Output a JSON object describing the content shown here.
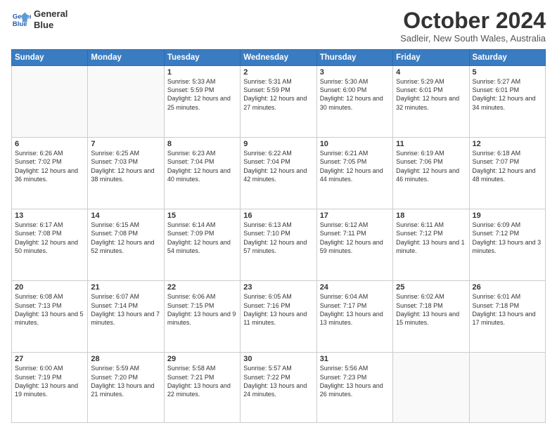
{
  "header": {
    "logo_line1": "General",
    "logo_line2": "Blue",
    "month": "October 2024",
    "location": "Sadleir, New South Wales, Australia"
  },
  "weekdays": [
    "Sunday",
    "Monday",
    "Tuesday",
    "Wednesday",
    "Thursday",
    "Friday",
    "Saturday"
  ],
  "weeks": [
    [
      {
        "day": "",
        "sunrise": "",
        "sunset": "",
        "daylight": ""
      },
      {
        "day": "",
        "sunrise": "",
        "sunset": "",
        "daylight": ""
      },
      {
        "day": "1",
        "sunrise": "Sunrise: 5:33 AM",
        "sunset": "Sunset: 5:59 PM",
        "daylight": "Daylight: 12 hours and 25 minutes."
      },
      {
        "day": "2",
        "sunrise": "Sunrise: 5:31 AM",
        "sunset": "Sunset: 5:59 PM",
        "daylight": "Daylight: 12 hours and 27 minutes."
      },
      {
        "day": "3",
        "sunrise": "Sunrise: 5:30 AM",
        "sunset": "Sunset: 6:00 PM",
        "daylight": "Daylight: 12 hours and 30 minutes."
      },
      {
        "day": "4",
        "sunrise": "Sunrise: 5:29 AM",
        "sunset": "Sunset: 6:01 PM",
        "daylight": "Daylight: 12 hours and 32 minutes."
      },
      {
        "day": "5",
        "sunrise": "Sunrise: 5:27 AM",
        "sunset": "Sunset: 6:01 PM",
        "daylight": "Daylight: 12 hours and 34 minutes."
      }
    ],
    [
      {
        "day": "6",
        "sunrise": "Sunrise: 6:26 AM",
        "sunset": "Sunset: 7:02 PM",
        "daylight": "Daylight: 12 hours and 36 minutes."
      },
      {
        "day": "7",
        "sunrise": "Sunrise: 6:25 AM",
        "sunset": "Sunset: 7:03 PM",
        "daylight": "Daylight: 12 hours and 38 minutes."
      },
      {
        "day": "8",
        "sunrise": "Sunrise: 6:23 AM",
        "sunset": "Sunset: 7:04 PM",
        "daylight": "Daylight: 12 hours and 40 minutes."
      },
      {
        "day": "9",
        "sunrise": "Sunrise: 6:22 AM",
        "sunset": "Sunset: 7:04 PM",
        "daylight": "Daylight: 12 hours and 42 minutes."
      },
      {
        "day": "10",
        "sunrise": "Sunrise: 6:21 AM",
        "sunset": "Sunset: 7:05 PM",
        "daylight": "Daylight: 12 hours and 44 minutes."
      },
      {
        "day": "11",
        "sunrise": "Sunrise: 6:19 AM",
        "sunset": "Sunset: 7:06 PM",
        "daylight": "Daylight: 12 hours and 46 minutes."
      },
      {
        "day": "12",
        "sunrise": "Sunrise: 6:18 AM",
        "sunset": "Sunset: 7:07 PM",
        "daylight": "Daylight: 12 hours and 48 minutes."
      }
    ],
    [
      {
        "day": "13",
        "sunrise": "Sunrise: 6:17 AM",
        "sunset": "Sunset: 7:08 PM",
        "daylight": "Daylight: 12 hours and 50 minutes."
      },
      {
        "day": "14",
        "sunrise": "Sunrise: 6:15 AM",
        "sunset": "Sunset: 7:08 PM",
        "daylight": "Daylight: 12 hours and 52 minutes."
      },
      {
        "day": "15",
        "sunrise": "Sunrise: 6:14 AM",
        "sunset": "Sunset: 7:09 PM",
        "daylight": "Daylight: 12 hours and 54 minutes."
      },
      {
        "day": "16",
        "sunrise": "Sunrise: 6:13 AM",
        "sunset": "Sunset: 7:10 PM",
        "daylight": "Daylight: 12 hours and 57 minutes."
      },
      {
        "day": "17",
        "sunrise": "Sunrise: 6:12 AM",
        "sunset": "Sunset: 7:11 PM",
        "daylight": "Daylight: 12 hours and 59 minutes."
      },
      {
        "day": "18",
        "sunrise": "Sunrise: 6:11 AM",
        "sunset": "Sunset: 7:12 PM",
        "daylight": "Daylight: 13 hours and 1 minute."
      },
      {
        "day": "19",
        "sunrise": "Sunrise: 6:09 AM",
        "sunset": "Sunset: 7:12 PM",
        "daylight": "Daylight: 13 hours and 3 minutes."
      }
    ],
    [
      {
        "day": "20",
        "sunrise": "Sunrise: 6:08 AM",
        "sunset": "Sunset: 7:13 PM",
        "daylight": "Daylight: 13 hours and 5 minutes."
      },
      {
        "day": "21",
        "sunrise": "Sunrise: 6:07 AM",
        "sunset": "Sunset: 7:14 PM",
        "daylight": "Daylight: 13 hours and 7 minutes."
      },
      {
        "day": "22",
        "sunrise": "Sunrise: 6:06 AM",
        "sunset": "Sunset: 7:15 PM",
        "daylight": "Daylight: 13 hours and 9 minutes."
      },
      {
        "day": "23",
        "sunrise": "Sunrise: 6:05 AM",
        "sunset": "Sunset: 7:16 PM",
        "daylight": "Daylight: 13 hours and 11 minutes."
      },
      {
        "day": "24",
        "sunrise": "Sunrise: 6:04 AM",
        "sunset": "Sunset: 7:17 PM",
        "daylight": "Daylight: 13 hours and 13 minutes."
      },
      {
        "day": "25",
        "sunrise": "Sunrise: 6:02 AM",
        "sunset": "Sunset: 7:18 PM",
        "daylight": "Daylight: 13 hours and 15 minutes."
      },
      {
        "day": "26",
        "sunrise": "Sunrise: 6:01 AM",
        "sunset": "Sunset: 7:18 PM",
        "daylight": "Daylight: 13 hours and 17 minutes."
      }
    ],
    [
      {
        "day": "27",
        "sunrise": "Sunrise: 6:00 AM",
        "sunset": "Sunset: 7:19 PM",
        "daylight": "Daylight: 13 hours and 19 minutes."
      },
      {
        "day": "28",
        "sunrise": "Sunrise: 5:59 AM",
        "sunset": "Sunset: 7:20 PM",
        "daylight": "Daylight: 13 hours and 21 minutes."
      },
      {
        "day": "29",
        "sunrise": "Sunrise: 5:58 AM",
        "sunset": "Sunset: 7:21 PM",
        "daylight": "Daylight: 13 hours and 22 minutes."
      },
      {
        "day": "30",
        "sunrise": "Sunrise: 5:57 AM",
        "sunset": "Sunset: 7:22 PM",
        "daylight": "Daylight: 13 hours and 24 minutes."
      },
      {
        "day": "31",
        "sunrise": "Sunrise: 5:56 AM",
        "sunset": "Sunset: 7:23 PM",
        "daylight": "Daylight: 13 hours and 26 minutes."
      },
      {
        "day": "",
        "sunrise": "",
        "sunset": "",
        "daylight": ""
      },
      {
        "day": "",
        "sunrise": "",
        "sunset": "",
        "daylight": ""
      }
    ]
  ]
}
